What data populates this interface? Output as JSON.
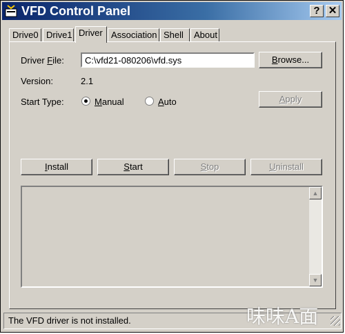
{
  "window": {
    "title": "VFD Control Panel",
    "help_label": "?",
    "close_label": "✕"
  },
  "tabs": [
    {
      "label": "Drive0"
    },
    {
      "label": "Drive1"
    },
    {
      "label": "Driver"
    },
    {
      "label": "Association"
    },
    {
      "label": "Shell"
    },
    {
      "label": "About"
    }
  ],
  "active_tab": "Driver",
  "driver": {
    "file_label_pre": "Driver ",
    "file_label_key": "F",
    "file_label_post": "ile:",
    "file_value": "C:\\vfd21-080206\\vfd.sys",
    "browse_key": "B",
    "browse_rest": "rowse...",
    "version_label": "Version:",
    "version_value": "2.1",
    "start_type_label": "Start Type:",
    "manual_key": "M",
    "manual_rest": "anual",
    "auto_key": "A",
    "auto_rest": "uto",
    "start_type_selected": "Manual",
    "apply_key": "A",
    "apply_rest": "pply"
  },
  "actions": {
    "install_key": "I",
    "install_rest": "nstall",
    "start_key": "S",
    "start_rest": "tart",
    "stop_key": "S",
    "stop_rest": "top",
    "uninstall_key": "U",
    "uninstall_rest": "ninstall"
  },
  "scroll": {
    "up": "▲",
    "down": "▼"
  },
  "status_text": "The VFD driver is not installed.",
  "watermark": "味味A面",
  "colors": {
    "title_start": "#0a246a",
    "title_end": "#a6caf0",
    "face": "#d4d0c8",
    "disabled_text": "#808080"
  }
}
